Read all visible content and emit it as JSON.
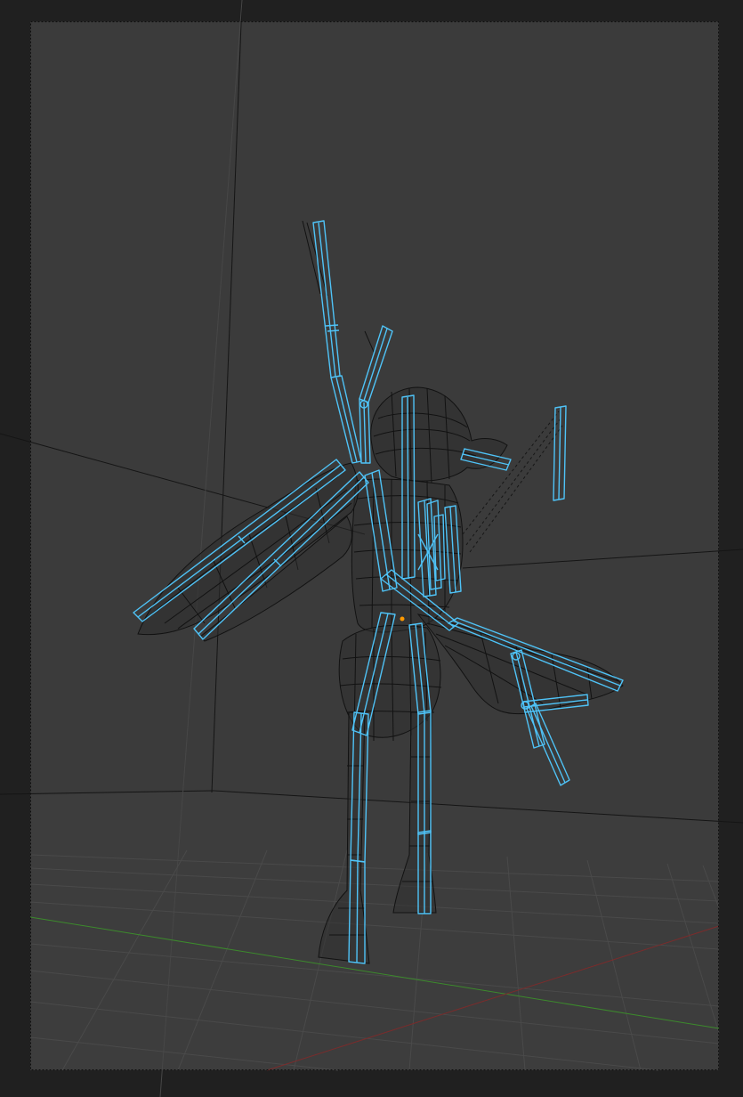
{
  "viewport": {
    "view": "camera-perspective",
    "background_color": "#3b3b3b",
    "outer_color": "#202020",
    "frame_color": "#111111",
    "grid_color": "#4d4d4d",
    "x_axis_color": "#8a2f2f",
    "y_axis_color": "#3c8a2c",
    "bone_color": "#4fc3f7",
    "mesh_color": "#121212",
    "active_bone_color": "#ff9900"
  },
  "scene": {
    "object": "armature-with-wireframe-mesh",
    "display_mode": "wireframe"
  }
}
